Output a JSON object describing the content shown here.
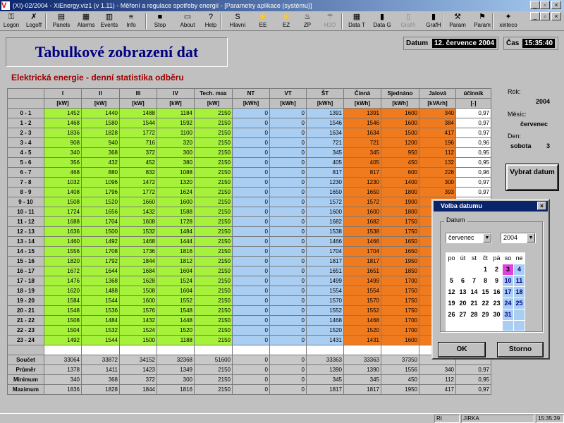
{
  "window": {
    "title": "(XI)-02/2004 - XiEnergy.viz1 (v 1.11) - Měření a regulace spotřeby energií - [Parametry aplikace (systému)]",
    "minimize": "_",
    "restore": "▫",
    "close": "×",
    "mdi_minimize": "_",
    "mdi_restore": "▫",
    "mdi_close": "×"
  },
  "toolbar": [
    {
      "label": "Logon",
      "icon": "key-icon",
      "glyph": "⚿",
      "enabled": true
    },
    {
      "label": "Logoff",
      "icon": "key-x-icon",
      "glyph": "✗",
      "enabled": true
    },
    {
      "label": "Panels",
      "icon": "panels-icon",
      "glyph": "▤",
      "enabled": true
    },
    {
      "label": "Alarms",
      "icon": "alarm-icon",
      "glyph": "▦",
      "enabled": true
    },
    {
      "label": "Events",
      "icon": "events-icon",
      "glyph": "▥",
      "enabled": true
    },
    {
      "label": "Info",
      "icon": "info-icon",
      "glyph": "≡",
      "enabled": true
    },
    {
      "label": "Stop",
      "icon": "stop-icon",
      "glyph": "■",
      "enabled": true
    },
    {
      "label": "About",
      "icon": "about-icon",
      "glyph": "▭",
      "enabled": true
    },
    {
      "label": "Help",
      "icon": "help-icon",
      "glyph": "?",
      "enabled": true
    },
    {
      "label": "Hlavní",
      "icon": "main-icon",
      "glyph": "S",
      "enabled": true
    },
    {
      "label": "EE",
      "icon": "electricity-icon",
      "glyph": "⚡",
      "enabled": true
    },
    {
      "label": "EZ",
      "icon": "ez-icon",
      "glyph": "⚡",
      "enabled": true
    },
    {
      "label": "ZP",
      "icon": "gas-icon",
      "glyph": "♨",
      "enabled": true
    },
    {
      "label": "H2O",
      "icon": "water-icon",
      "glyph": "☂",
      "enabled": false
    },
    {
      "label": "Data T",
      "icon": "table-icon",
      "glyph": "▦",
      "enabled": true
    },
    {
      "label": "Data G",
      "icon": "bar-chart-icon",
      "glyph": "▮",
      "enabled": true
    },
    {
      "label": "GrafA",
      "icon": "chart-a-icon",
      "glyph": "▯",
      "enabled": false
    },
    {
      "label": "GrafH",
      "icon": "chart-h-icon",
      "glyph": "▮",
      "enabled": true
    },
    {
      "label": "Param",
      "icon": "tools-icon",
      "glyph": "⚒",
      "enabled": true
    },
    {
      "label": "Param",
      "icon": "param-icon",
      "glyph": "⚑",
      "enabled": true
    },
    {
      "label": "xinteco",
      "icon": "xinteco-icon",
      "glyph": "✦",
      "enabled": true
    }
  ],
  "header": {
    "title": "Tabulkové zobrazení dat",
    "subtitle": "Elektrická energie - denní statistika odběru",
    "date_label": "Datum",
    "date_value": "12. července 2004",
    "time_label": "Čas",
    "time_value": "15:35:40"
  },
  "columns": {
    "names": [
      "I",
      "II",
      "III",
      "IV",
      "Tech. max",
      "NT",
      "VT",
      "ŠT",
      "Činná",
      "Sjednáno",
      "Jalová",
      "účinník"
    ],
    "units": [
      "[kW]",
      "[kW]",
      "[kW]",
      "[kW]",
      "[kW]",
      "[kWh]",
      "[kWh]",
      "[kWh]",
      "[kWh]",
      "[kWh]",
      "[kVArh]",
      "[-]"
    ]
  },
  "rows": [
    {
      "label": "0 - 1",
      "v": [
        "1452",
        "1440",
        "1488",
        "1184",
        "2150",
        "0",
        "0",
        "1391",
        "1391",
        "1600",
        "340",
        "0,97"
      ]
    },
    {
      "label": "1 - 2",
      "v": [
        "1468",
        "1580",
        "1544",
        "1592",
        "2150",
        "0",
        "0",
        "1546",
        "1546",
        "1600",
        "384",
        "0,97"
      ]
    },
    {
      "label": "2 - 3",
      "v": [
        "1836",
        "1828",
        "1772",
        "1100",
        "2150",
        "0",
        "0",
        "1634",
        "1634",
        "1500",
        "417",
        "0,97"
      ]
    },
    {
      "label": "3 - 4",
      "v": [
        "908",
        "940",
        "716",
        "320",
        "2150",
        "0",
        "0",
        "721",
        "721",
        "1200",
        "196",
        "0,96"
      ]
    },
    {
      "label": "4 - 5",
      "v": [
        "340",
        "368",
        "372",
        "300",
        "2150",
        "0",
        "0",
        "345",
        "345",
        "950",
        "112",
        "0,95"
      ]
    },
    {
      "label": "5 - 6",
      "v": [
        "356",
        "432",
        "452",
        "380",
        "2150",
        "0",
        "0",
        "405",
        "405",
        "450",
        "132",
        "0,95"
      ]
    },
    {
      "label": "6 - 7",
      "v": [
        "468",
        "880",
        "832",
        "1088",
        "2150",
        "0",
        "0",
        "817",
        "817",
        "600",
        "228",
        "0,96"
      ]
    },
    {
      "label": "7 - 8",
      "v": [
        "1032",
        "1096",
        "1472",
        "1320",
        "2150",
        "0",
        "0",
        "1230",
        "1230",
        "1400",
        "300",
        "0,97"
      ]
    },
    {
      "label": "8 - 9",
      "v": [
        "1408",
        "1796",
        "1772",
        "1624",
        "2150",
        "0",
        "0",
        "1650",
        "1650",
        "1800",
        "393",
        "0,97"
      ]
    },
    {
      "label": "9 - 10",
      "v": [
        "1508",
        "1520",
        "1660",
        "1600",
        "2150",
        "0",
        "0",
        "1572",
        "1572",
        "1900",
        "",
        "",
        ""
      ]
    },
    {
      "label": "10 - 11",
      "v": [
        "1724",
        "1656",
        "1432",
        "1588",
        "2150",
        "0",
        "0",
        "1600",
        "1600",
        "1800",
        "",
        ""
      ]
    },
    {
      "label": "11 - 12",
      "v": [
        "1688",
        "1704",
        "1608",
        "1728",
        "2150",
        "0",
        "0",
        "1682",
        "1682",
        "1750",
        "",
        ""
      ]
    },
    {
      "label": "12 - 13",
      "v": [
        "1636",
        "1500",
        "1532",
        "1484",
        "2150",
        "0",
        "0",
        "1538",
        "1538",
        "1750",
        "",
        ""
      ]
    },
    {
      "label": "13 - 14",
      "v": [
        "1460",
        "1492",
        "1468",
        "1444",
        "2150",
        "0",
        "0",
        "1466",
        "1466",
        "1650",
        "",
        ""
      ]
    },
    {
      "label": "14 - 15",
      "v": [
        "1556",
        "1708",
        "1736",
        "1816",
        "2150",
        "0",
        "0",
        "1704",
        "1704",
        "1650",
        "",
        ""
      ]
    },
    {
      "label": "15 - 16",
      "v": [
        "1820",
        "1792",
        "1844",
        "1812",
        "2150",
        "0",
        "0",
        "1817",
        "1817",
        "1950",
        "",
        ""
      ]
    },
    {
      "label": "16 - 17",
      "v": [
        "1672",
        "1644",
        "1684",
        "1604",
        "2150",
        "0",
        "0",
        "1651",
        "1651",
        "1850",
        "",
        ""
      ]
    },
    {
      "label": "17 - 18",
      "v": [
        "1476",
        "1368",
        "1628",
        "1524",
        "2150",
        "0",
        "0",
        "1499",
        "1499",
        "1700",
        "",
        ""
      ]
    },
    {
      "label": "18 - 19",
      "v": [
        "1620",
        "1488",
        "1508",
        "1604",
        "2150",
        "0",
        "0",
        "1554",
        "1554",
        "1750",
        "",
        ""
      ]
    },
    {
      "label": "19 - 20",
      "v": [
        "1584",
        "1544",
        "1600",
        "1552",
        "2150",
        "0",
        "0",
        "1570",
        "1570",
        "1750",
        "",
        ""
      ]
    },
    {
      "label": "20 - 21",
      "v": [
        "1548",
        "1536",
        "1576",
        "1548",
        "2150",
        "0",
        "0",
        "1552",
        "1552",
        "1750",
        "",
        ""
      ]
    },
    {
      "label": "21 - 22",
      "v": [
        "1508",
        "1484",
        "1432",
        "1448",
        "2150",
        "0",
        "0",
        "1468",
        "1468",
        "1700",
        "",
        ""
      ]
    },
    {
      "label": "22 - 23",
      "v": [
        "1504",
        "1532",
        "1524",
        "1520",
        "2150",
        "0",
        "0",
        "1520",
        "1520",
        "1700",
        "",
        ""
      ]
    },
    {
      "label": "23 - 24",
      "v": [
        "1492",
        "1544",
        "1500",
        "1188",
        "2150",
        "0",
        "0",
        "1431",
        "1431",
        "1600",
        "",
        ""
      ]
    }
  ],
  "summary": [
    {
      "label": "Součet",
      "v": [
        "33064",
        "33872",
        "34152",
        "32368",
        "51600",
        "0",
        "0",
        "33363",
        "33363",
        "37350",
        "",
        ""
      ]
    },
    {
      "label": "Průměr",
      "v": [
        "1378",
        "1411",
        "1423",
        "1349",
        "2150",
        "0",
        "0",
        "1390",
        "1390",
        "1556",
        "340",
        "0,97"
      ]
    },
    {
      "label": "Minimum",
      "v": [
        "340",
        "368",
        "372",
        "300",
        "2150",
        "0",
        "0",
        "345",
        "345",
        "450",
        "112",
        "0,95"
      ]
    },
    {
      "label": "Maximum",
      "v": [
        "1836",
        "1828",
        "1844",
        "1816",
        "2150",
        "0",
        "0",
        "1817",
        "1817",
        "1950",
        "417",
        "0,97"
      ]
    }
  ],
  "side": {
    "year_label": "Rok:",
    "year_value": "2004",
    "month_label": "Měsíc:",
    "month_value": "červenec",
    "day_label": "Den:",
    "day_name": "sobota",
    "day_number": "3",
    "select_button": "Vybrat datum"
  },
  "dialog": {
    "title": "Volba datumu",
    "group_label": "Datum",
    "month_value": "červenec",
    "year_value": "2004",
    "weekdays": [
      "po",
      "út",
      "st",
      "čt",
      "pá",
      "so",
      "ne"
    ],
    "weeks": [
      [
        "",
        "",
        "",
        "1",
        "2",
        "3",
        "4"
      ],
      [
        "5",
        "6",
        "7",
        "8",
        "9",
        "10",
        "11"
      ],
      [
        "12",
        "13",
        "14",
        "15",
        "16",
        "17",
        "18"
      ],
      [
        "19",
        "20",
        "21",
        "22",
        "23",
        "24",
        "25"
      ],
      [
        "26",
        "27",
        "28",
        "29",
        "30",
        "31",
        ""
      ],
      [
        "",
        "",
        "",
        "",
        "",
        "",
        ""
      ]
    ],
    "selected_day": "3",
    "ok": "OK",
    "cancel": "Storno"
  },
  "statusbar": {
    "mode": "Rt",
    "user": "JIRKA",
    "time": "15:35:39"
  }
}
